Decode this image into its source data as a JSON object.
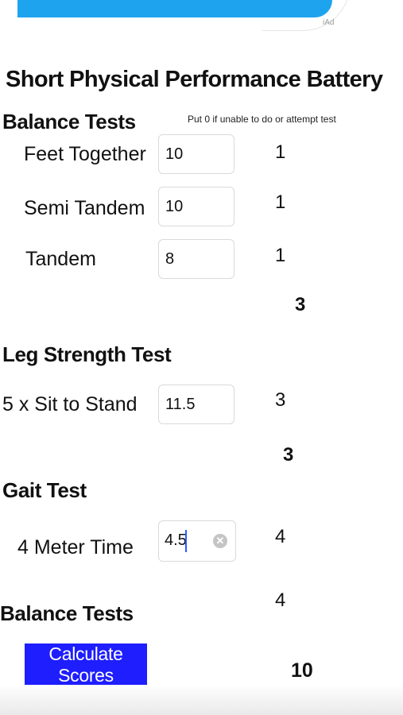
{
  "ad": {
    "tag": "iAd",
    "banner_color": "#1ea3ee"
  },
  "title": "Short Physical Performance Battery",
  "balance": {
    "heading": "Balance Tests",
    "hint": "Put 0 if unable to do or attempt test",
    "rows": [
      {
        "label": "Feet Together",
        "value": "10",
        "score": "1"
      },
      {
        "label": "Semi Tandem",
        "value": "10",
        "score": "1"
      },
      {
        "label": "Tandem",
        "value": "8",
        "score": "1"
      }
    ],
    "subtotal": "3"
  },
  "leg": {
    "heading": "Leg Strength Test",
    "label": "5 x Sit to Stand",
    "value": "11.5",
    "score": "3",
    "subtotal": "3"
  },
  "gait": {
    "heading": "Gait Test",
    "label": "4 Meter Time",
    "value": "4.5",
    "score": "4",
    "clear_icon": "clear-circle-x"
  },
  "summary": {
    "heading": "Balance Tests",
    "subtotal": "4",
    "button_label": "Calculate Scores",
    "button_color": "#1e1eff",
    "total": "10"
  }
}
